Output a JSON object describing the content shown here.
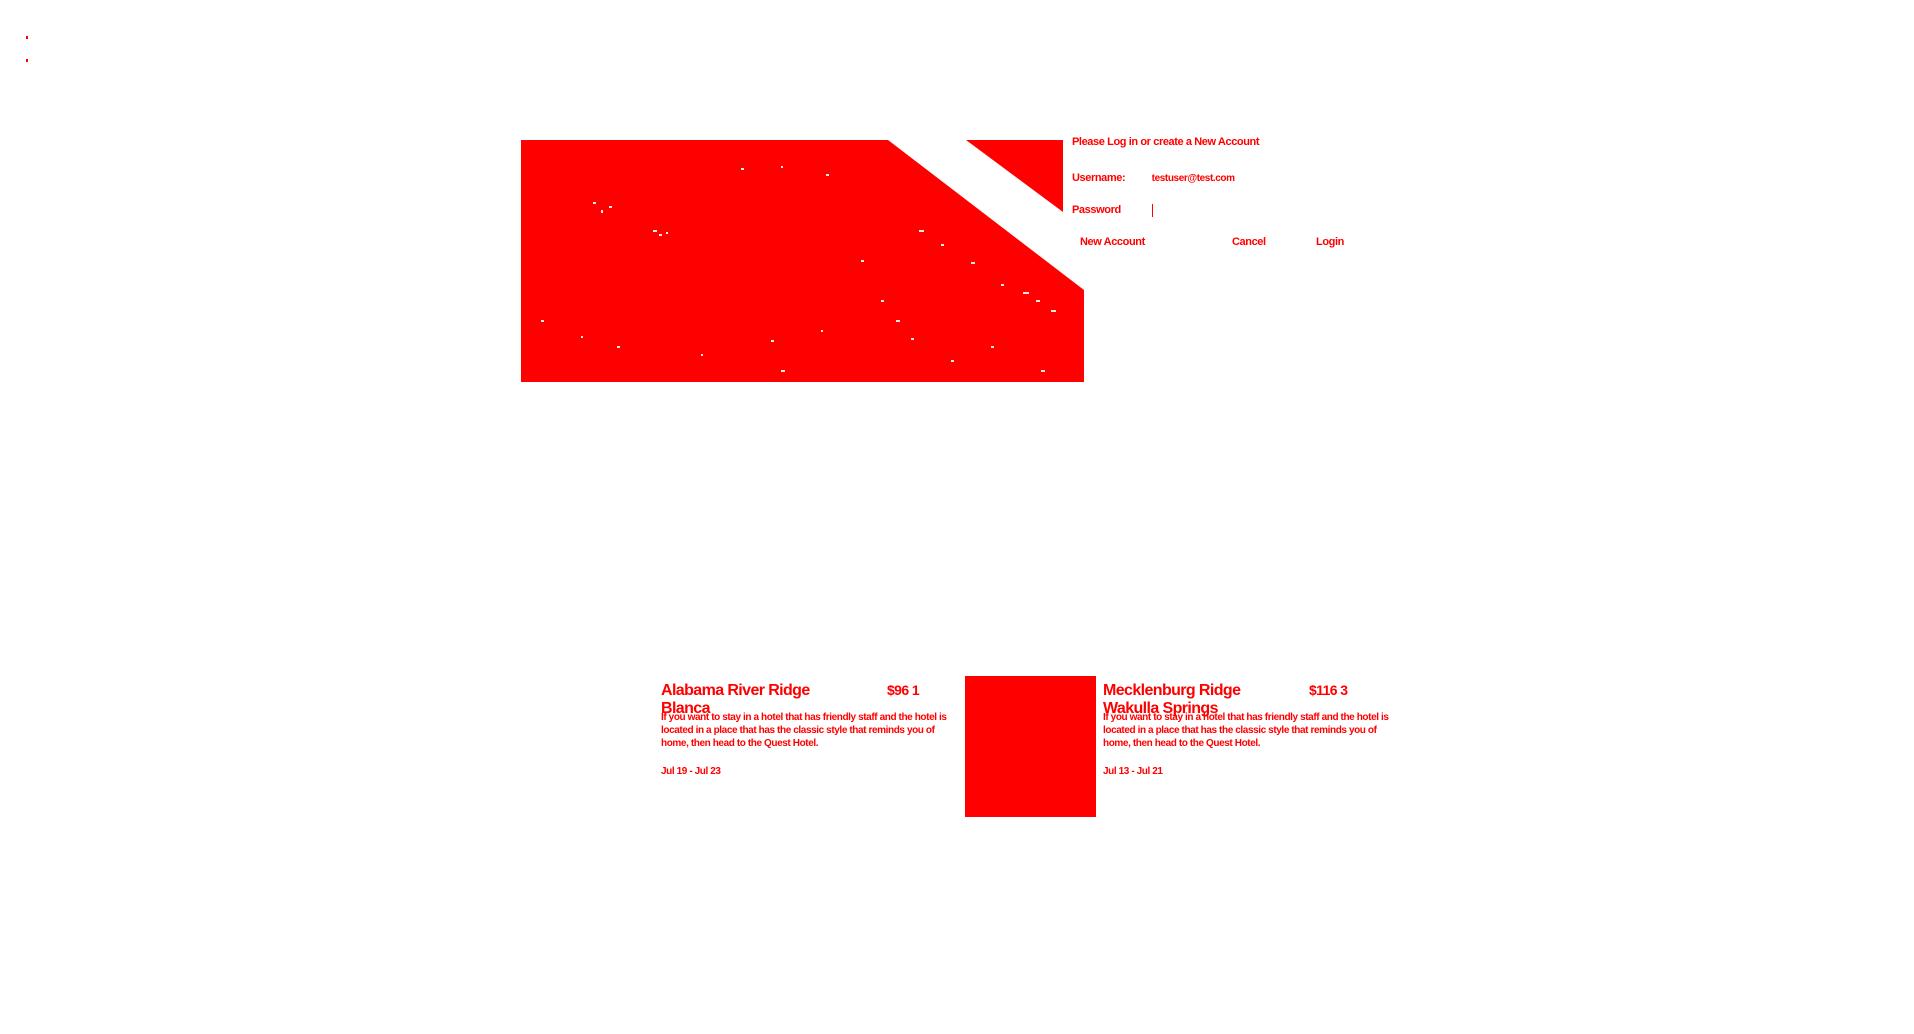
{
  "colors": {
    "accent": "#ff0000",
    "background": "#ffffff"
  },
  "login": {
    "prompt": "Please Log in or create a New Account",
    "username_label": "Username:",
    "username_value": "testuser@test.com",
    "password_label": "Password",
    "password_value": "",
    "new_account_label": "New Account",
    "cancel_label": "Cancel",
    "login_label": "Login"
  },
  "hotels": [
    {
      "name": "Alabama River Ridge Blanca",
      "price": "$96 1",
      "description": "If you want to stay in a hotel that has friendly staff and the hotel is located in a place that has the classic style that reminds you of home, then head to the Quest Hotel.",
      "dates": "Jul 19 - Jul 23"
    },
    {
      "name": "Mecklenburg Ridge Wakulla Springs",
      "price": "$116 3",
      "description": "If you want to stay in a hotel that has friendly staff and the hotel is located in a place that has the classic style that reminds you of home, then head to the Quest Hotel.",
      "dates": "Jul 13 - Jul 21"
    }
  ]
}
